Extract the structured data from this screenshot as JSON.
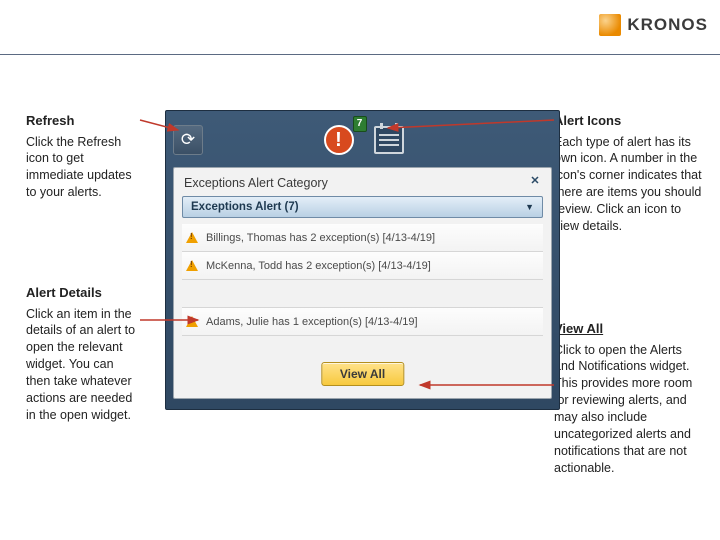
{
  "brand": {
    "name": "KRONOS"
  },
  "annotations": {
    "refresh": {
      "title": "Refresh",
      "body": "Click the Refresh icon to get immediate updates to your alerts."
    },
    "details": {
      "title": "Alert Details",
      "body": "Click an item in the details of an alert to open the relevant widget. You can then take whatever actions are needed in the open widget."
    },
    "icons": {
      "title": "Alert Icons",
      "body": "Each type of alert has its own icon. A number in the icon's corner indicates that there are items you should review. Click an icon to view details."
    },
    "viewall": {
      "title": "View All",
      "body": "Click to open the Alerts and Notifications widget. This provides more room for reviewing alerts, and may also include uncategorized alerts and notifications that are not actionable."
    }
  },
  "widget": {
    "badge": "7",
    "panel_title": "Exceptions Alert Category",
    "dropdown": "Exceptions Alert (7)",
    "rows": [
      "Billings, Thomas has 2 exception(s) [4/13-4/19]",
      "McKenna, Todd has 2 exception(s) [4/13-4/19]",
      "Adams, Julie has 1 exception(s) [4/13-4/19]"
    ],
    "viewall_label": "View All"
  }
}
